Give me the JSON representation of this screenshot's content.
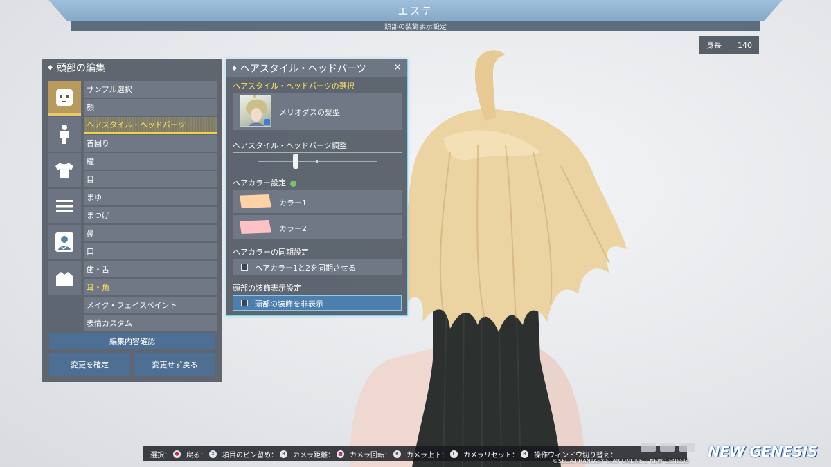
{
  "header": {
    "title": "エステ",
    "subtitle": "頭部の装飾表示設定",
    "height_label": "身長",
    "height_value": "140"
  },
  "left_panel": {
    "title": "頭部の編集",
    "categories": [
      "face-icon",
      "body-icon",
      "clothing-icon",
      "list-icon",
      "profile-icon",
      "accessory-icon"
    ],
    "items": [
      "サンプル選択",
      "顔",
      "ヘアスタイル・ヘッドパーツ",
      "首回り",
      "瞳",
      "目",
      "まゆ",
      "まつげ",
      "鼻",
      "口",
      "歯・舌",
      "耳・角",
      "メイク・フェイスペイント",
      "表情カスタム"
    ],
    "confirm_label": "編集内容確認",
    "apply_label": "変更を確定",
    "discard_label": "変更せず戻る"
  },
  "hair_panel": {
    "title": "ヘアスタイル・ヘッドパーツ",
    "section_select": "ヘアスタイル・ヘッドパーツの選択",
    "hair_name": "メリオダスの髪型",
    "section_adjust": "ヘアスタイル・ヘッドパーツ調整",
    "adjust_level": 0.32,
    "section_color": "ヘアカラー設定",
    "color1_label": "カラー1",
    "color1": "#fdd3a6",
    "color2_label": "カラー2",
    "color2": "#fdc2c6",
    "section_sync": "ヘアカラーの同期設定",
    "sync_label": "ヘアカラー1と2を同期させる",
    "sync_checked": false,
    "section_deco": "頭部の装飾表示設定",
    "deco_label": "頭部の装飾を非表示",
    "deco_checked": false
  },
  "controls": {
    "select": "選択：",
    "back": "戻る：",
    "pin": "項目のピン留め：",
    "cam_distance": "カメラ距離：",
    "cam_rotate": "カメラ回転：",
    "cam_updown": "カメラ上下：",
    "cam_reset": "カメラリセット：",
    "window_switch": "操作ウィンドウ切り替え："
  },
  "footer": {
    "logo": "NEW GENESIS",
    "copyright": "©SEGA PHANTASY STAR ONLINE 2 NEW GENESIS"
  }
}
